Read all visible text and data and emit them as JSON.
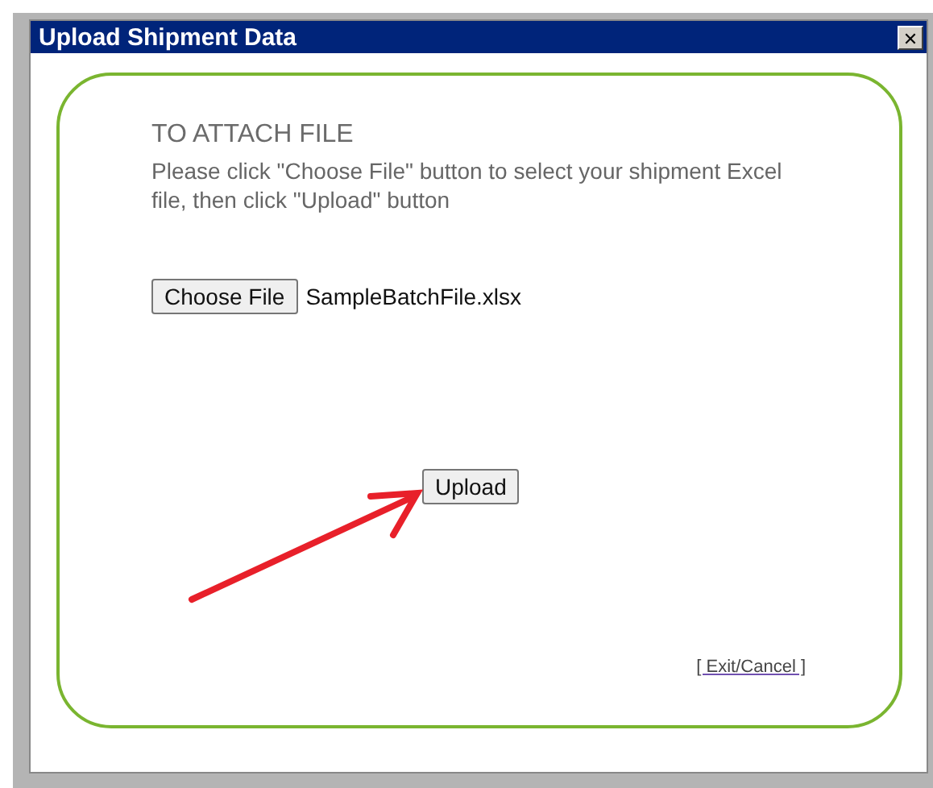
{
  "window": {
    "title": "Upload Shipment Data",
    "close": "✕"
  },
  "heading": "TO ATTACH FILE",
  "instructions": "Please click \"Choose File\" button to select your shipment Excel file, then click \"Upload\" button",
  "file_picker": {
    "button": "Choose File",
    "file_name": "SampleBatchFile.xlsx"
  },
  "upload_button": "Upload",
  "exit_link": "[ Exit/Cancel ]"
}
